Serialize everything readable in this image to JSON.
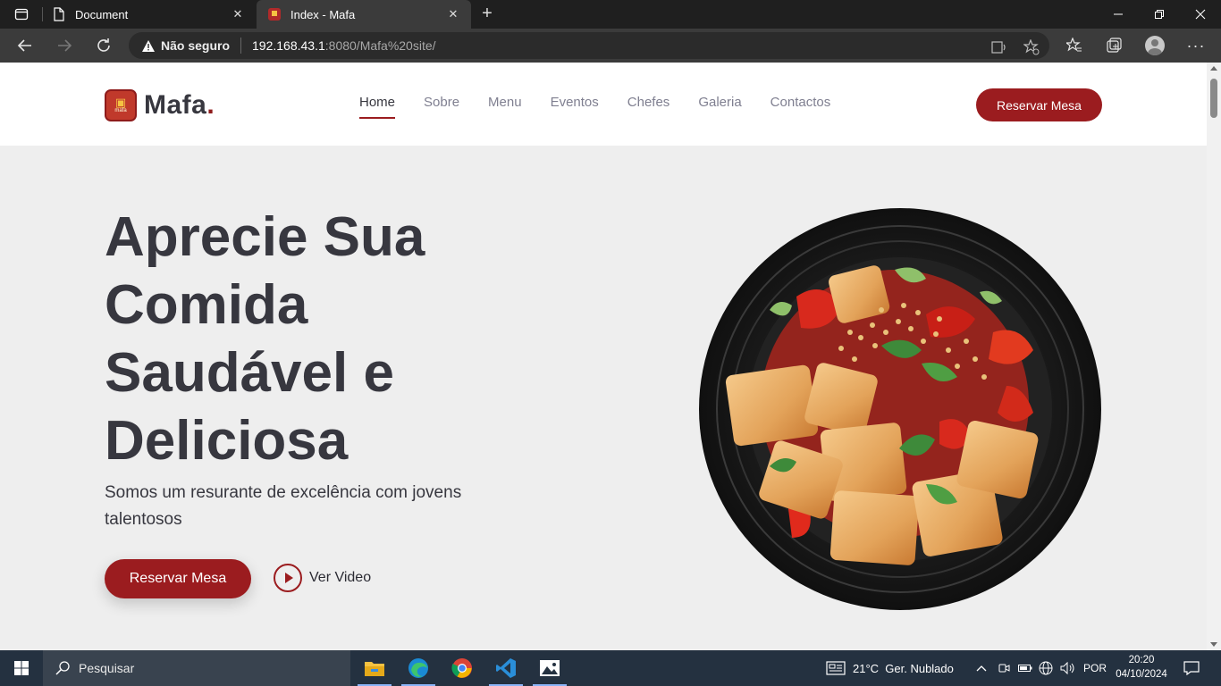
{
  "browser": {
    "tabs": [
      {
        "title": "Document",
        "active": false
      },
      {
        "title": "Index - Mafa",
        "active": true
      }
    ],
    "security_label": "Não seguro",
    "url_host": "192.168.43.1",
    "url_path": ":8080/Mafa%20site/"
  },
  "site": {
    "brand": "Mafa",
    "brand_dot": ".",
    "logo_badge": "mafa",
    "nav": [
      "Home",
      "Sobre",
      "Menu",
      "Eventos",
      "Chefes",
      "Galeria",
      "Contactos"
    ],
    "nav_active": "Home",
    "reserve_top_label": "Reservar Mesa",
    "hero": {
      "title_lines": [
        "Aprecie Sua",
        "Comida",
        "Saudável e",
        "Deliciosa"
      ],
      "subtitle": "Somos um resurante de excelência com jovens talentosos",
      "reserve_label": "Reservar Mesa",
      "video_label": "Ver Video"
    },
    "colors": {
      "accent": "#9b1c1f",
      "text_dark": "#37373f",
      "nav_text": "#7f7f90",
      "hero_bg": "#eeeeee"
    }
  },
  "taskbar": {
    "search_placeholder": "Pesquisar",
    "weather": "21°C  Ger. Nublado",
    "language": "POR",
    "time": "20:20",
    "date": "04/10/2024",
    "apps": [
      "file-explorer-icon",
      "edge-icon",
      "chrome-icon",
      "vscode-icon",
      "photos-icon"
    ]
  }
}
